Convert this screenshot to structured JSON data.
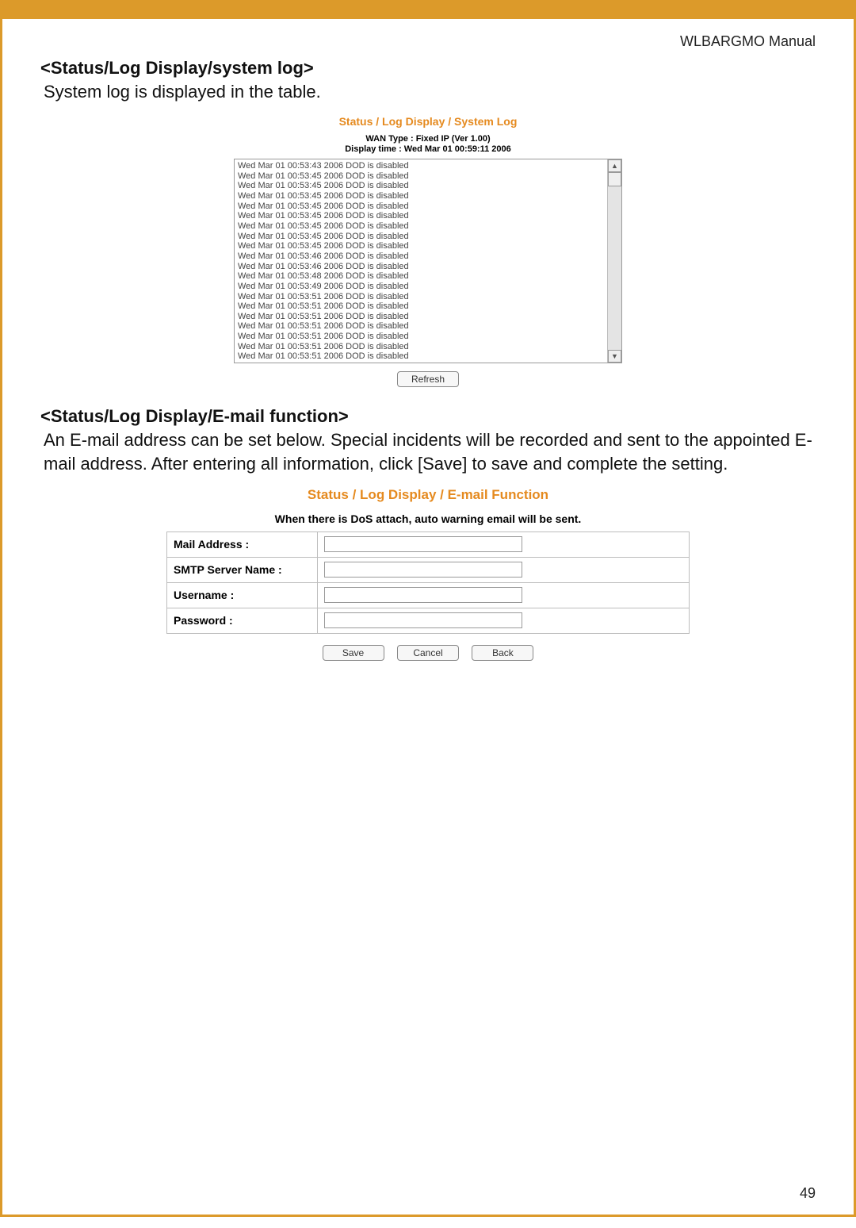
{
  "header": {
    "manual": "WLBARGMO Manual"
  },
  "section1": {
    "title": "<Status/Log Display/system log>",
    "desc": "System log is displayed in the table."
  },
  "syslog": {
    "title": "Status / Log Display / System Log",
    "wan_type": "WAN Type : Fixed IP (Ver 1.00)",
    "display_time": "Display time : Wed Mar 01 00:59:11 2006",
    "lines": [
      "Wed Mar 01 00:53:43 2006 DOD is disabled",
      "Wed Mar 01 00:53:45 2006 DOD is disabled",
      "Wed Mar 01 00:53:45 2006 DOD is disabled",
      "Wed Mar 01 00:53:45 2006 DOD is disabled",
      "Wed Mar 01 00:53:45 2006 DOD is disabled",
      "Wed Mar 01 00:53:45 2006 DOD is disabled",
      "Wed Mar 01 00:53:45 2006 DOD is disabled",
      "Wed Mar 01 00:53:45 2006 DOD is disabled",
      "Wed Mar 01 00:53:45 2006 DOD is disabled",
      "Wed Mar 01 00:53:46 2006 DOD is disabled",
      "Wed Mar 01 00:53:46 2006 DOD is disabled",
      "Wed Mar 01 00:53:48 2006 DOD is disabled",
      "Wed Mar 01 00:53:49 2006 DOD is disabled",
      "Wed Mar 01 00:53:51 2006 DOD is disabled",
      "Wed Mar 01 00:53:51 2006 DOD is disabled",
      "Wed Mar 01 00:53:51 2006 DOD is disabled",
      "Wed Mar 01 00:53:51 2006 DOD is disabled",
      "Wed Mar 01 00:53:51 2006 DOD is disabled",
      "Wed Mar 01 00:53:51 2006 DOD is disabled",
      "Wed Mar 01 00:53:51 2006 DOD is disabled"
    ],
    "refresh_label": "Refresh"
  },
  "section2": {
    "title": "<Status/Log Display/E-mail function>",
    "desc": "An E-mail address can be set below.  Special incidents will be recorded and sent to the appointed E-mail address.  After entering all information, click [Save] to save and complete the setting."
  },
  "email": {
    "title": "Status / Log Display / E-mail Function",
    "attach_note": "When there is DoS attach, auto warning email will be sent.",
    "rows": {
      "mail": "Mail Address :",
      "smtp": "SMTP Server Name :",
      "user": "Username :",
      "pass": "Password :"
    },
    "buttons": {
      "save": "Save",
      "cancel": "Cancel",
      "back": "Back"
    }
  },
  "page_number": "49"
}
